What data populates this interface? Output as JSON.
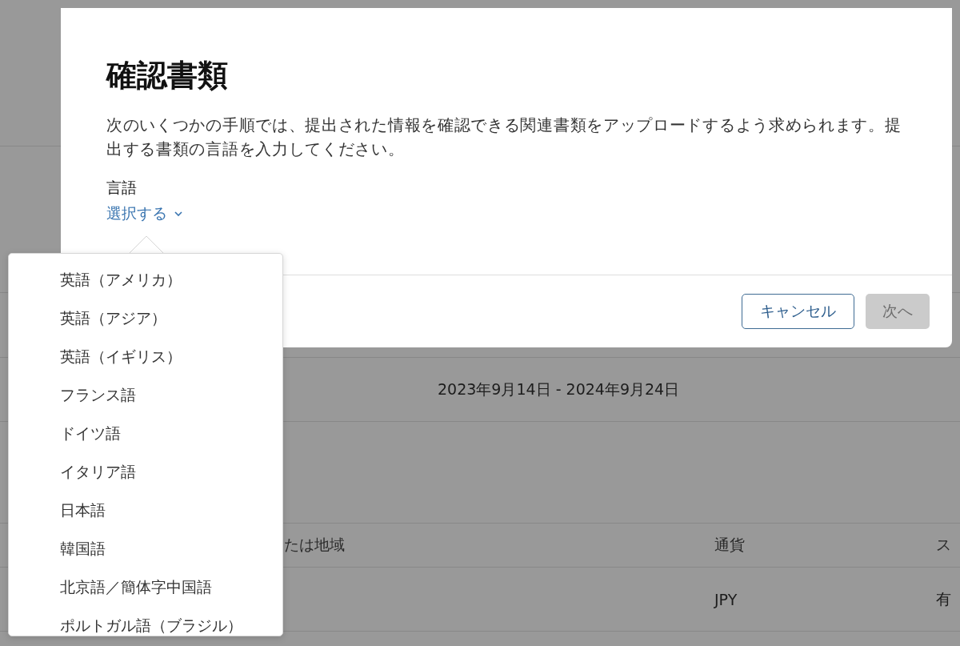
{
  "background": {
    "date_range": "2023年9月14日 - 2024年9月24日",
    "table": {
      "columns": [
        {
          "label": "たは地域"
        },
        {
          "label": "通貨"
        },
        {
          "label": "ス"
        }
      ],
      "rows": [
        {
          "currency": "JPY",
          "status": "有"
        }
      ]
    }
  },
  "dialog": {
    "title": "確認書類",
    "description": "次のいくつかの手順では、提出された情報を確認できる関連書類をアップロードするよう求められます。提出する書類の言語を入力してください。",
    "field_label": "言語",
    "select": {
      "label": "選択する",
      "expanded": true,
      "options": [
        {
          "label": "英語（アメリカ）",
          "selected": false
        },
        {
          "label": "英語（アジア）",
          "selected": false
        },
        {
          "label": "英語（イギリス）",
          "selected": false
        },
        {
          "label": "フランス語",
          "selected": false
        },
        {
          "label": "ドイツ語",
          "selected": false
        },
        {
          "label": "イタリア語",
          "selected": false
        },
        {
          "label": "日本語",
          "selected": false
        },
        {
          "label": "韓国語",
          "selected": false
        },
        {
          "label": "北京語／簡体字中国語",
          "selected": false
        },
        {
          "label": "ポルトガル語（ブラジル）",
          "selected": false
        }
      ]
    },
    "buttons": [
      {
        "label": "キャンセル",
        "kind": "secondary",
        "disabled": false
      },
      {
        "label": "次へ",
        "kind": "primary",
        "disabled": true
      }
    ]
  }
}
